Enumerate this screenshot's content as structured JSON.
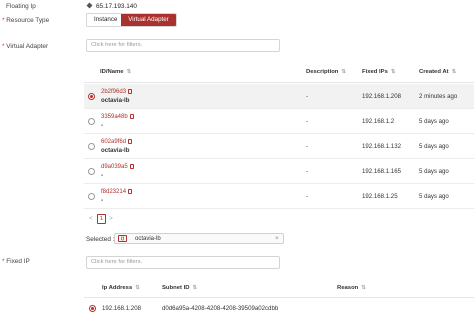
{
  "floating_ip": {
    "label": "Floating Ip",
    "value": "65.17.193.140"
  },
  "resource_type": {
    "label": "Resource Type",
    "options": [
      {
        "label": "Instance",
        "active": false
      },
      {
        "label": "Virtual Adapter",
        "active": true
      }
    ]
  },
  "virtual_adapter": {
    "label": "Virtual Adapter",
    "filter_placeholder": "Click here for filters.",
    "columns": [
      "ID/Name",
      "Description",
      "Fixed IPs",
      "Created At"
    ],
    "rows": [
      {
        "id": "2b2f96d3",
        "name": "octavia-lb",
        "description": "-",
        "fixed_ip": "192.168.1.208",
        "created": "2 minutes ago",
        "selected": true
      },
      {
        "id": "3359a48b",
        "name": "-",
        "description": "-",
        "fixed_ip": "192.168.1.2",
        "created": "5 days ago",
        "selected": false
      },
      {
        "id": "602a9f6d",
        "name": "octavia-lb",
        "description": "-",
        "fixed_ip": "192.168.1.132",
        "created": "5 days ago",
        "selected": false
      },
      {
        "id": "d9a039a5",
        "name": "-",
        "description": "-",
        "fixed_ip": "192.168.1.165",
        "created": "5 days ago",
        "selected": false
      },
      {
        "id": "f8d23214",
        "name": "-",
        "description": "-",
        "fixed_ip": "192.168.1.25",
        "created": "5 days ago",
        "selected": false
      }
    ],
    "pagination": {
      "prev": "<",
      "page": "1",
      "next": ">"
    },
    "selected_label": "Selected :",
    "selected_value": "octavia-lb"
  },
  "fixed_ip": {
    "label": "Fixed IP",
    "filter_placeholder": "Click here for filters.",
    "columns": [
      "Ip Address",
      "Subnet ID",
      "Reason"
    ],
    "rows": [
      {
        "ip": "192.168.1.208",
        "subnet": "d0d6a95a-4208-4208-4208-39509a02cdbb",
        "reason": "",
        "selected": true
      }
    ]
  },
  "colors": {
    "accent": "#b3302c",
    "active_segment": "#a9322f"
  }
}
